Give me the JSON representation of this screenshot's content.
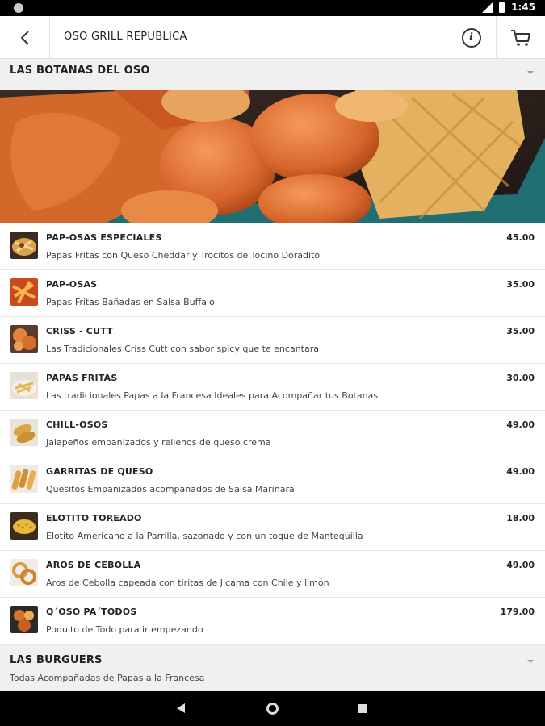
{
  "status_bar": {
    "time": "1:45"
  },
  "app_bar": {
    "title": "OSO GRILL REPUBLICA",
    "back_icon": "chevron-left-icon",
    "info_icon": "info-icon",
    "cart_icon": "cart-icon"
  },
  "sections": [
    {
      "title": "LAS BOTANAS DEL OSO"
    },
    {
      "title": "LAS BURGUERS",
      "subtitle": "Todas Acompañadas de Papas a la Francesa"
    }
  ],
  "menu_items": [
    {
      "name": "PAP-OSAS ESPECIALES",
      "description": "Papas Fritas con Queso Cheddar y Trocitos de Tocino Doradito",
      "price": "45.00"
    },
    {
      "name": "PAP-OSAS",
      "description": "Papas Fritas Bañadas en Salsa Buffalo",
      "price": "35.00"
    },
    {
      "name": "CRISS - CUTT",
      "description": "Las Tradicionales Criss Cutt con sabor spicy que te encantara",
      "price": "35.00"
    },
    {
      "name": "PAPAS FRITAS",
      "description": "Las tradicionales Papas a la Francesa Ideales para Acompañar tus Botanas",
      "price": "30.00"
    },
    {
      "name": "CHILL-OSOS",
      "description": "Jalapeños empanizados y rellenos de queso crema",
      "price": "49.00"
    },
    {
      "name": "GARRITAS DE QUESO",
      "description": "Quesitos Empanizados acompañados de Salsa Marinara",
      "price": "49.00"
    },
    {
      "name": "ELOTITO TOREADO",
      "description": "Elotito Americano a la Parrilla, sazonado y con un toque de Mantequilla",
      "price": "18.00"
    },
    {
      "name": "AROS DE CEBOLLA",
      "description": "Aros de Cebolla capeada con tiritas de Jicama con Chile y limón",
      "price": "49.00"
    },
    {
      "name": "Q´OSO PA´TODOS",
      "description": "Poquito de Todo para ir empezando",
      "price": "179.00"
    }
  ]
}
